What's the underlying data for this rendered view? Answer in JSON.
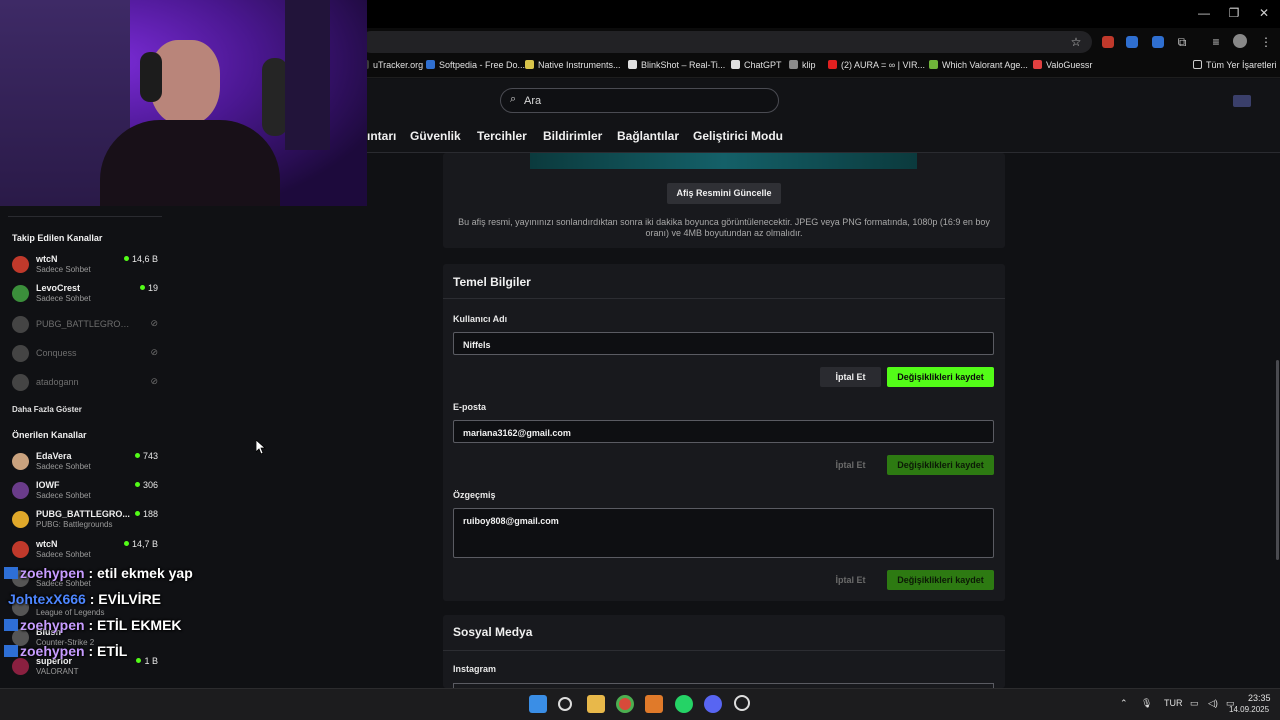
{
  "window": {
    "minimize": "—",
    "restore": "❐",
    "close": "✕"
  },
  "bookmarks": [
    {
      "label": "uTracker.org",
      "color": "#3a3a3a"
    },
    {
      "label": "Softpedia - Free Do...",
      "color": "#2f6fd0"
    },
    {
      "label": "Native Instruments...",
      "color": "#d8c44a"
    },
    {
      "label": "BlinkShot – Real-Ti...",
      "color": "#e0e0e0"
    },
    {
      "label": "ChatGPT",
      "color": "#e0e0e0"
    },
    {
      "label": "klip",
      "color": "#8a8a8a"
    },
    {
      "label": "(2) AURA = ∞ | VIR...",
      "color": "#e02020"
    },
    {
      "label": "Which Valorant Age...",
      "color": "#6fb43a"
    },
    {
      "label": "ValoGuessr",
      "color": "#e04040"
    }
  ],
  "bookmarks_other": "Tüm Yer İşaretleri",
  "search": {
    "placeholder": "Ara",
    "icon": "search-icon"
  },
  "tabs": [
    "ıntarı",
    "Güvenlik",
    "Tercihler",
    "Bildirimler",
    "Bağlantılar",
    "Geliştirici Modu"
  ],
  "banner": {
    "button": "Afiş Resmini Güncelle",
    "help": "Bu afiş resmi, yayınınızı sonlandırdıktan sonra iki dakika boyunca görüntülenecektir. JPEG veya PNG formatında, 1080p (16:9 en boy oranı) ve 4MB boyutundan az olmalıdır."
  },
  "basic_info": {
    "title": "Temel Bilgiler",
    "username_label": "Kullanıcı Adı",
    "username_value": "Niffels",
    "email_label": "E-posta",
    "email_value": "mariana3162@gmail.com",
    "bio_label": "Özgeçmiş",
    "bio_value": "ruiboy808@gmail.com",
    "cancel": "İptal Et",
    "save": "Değişiklikleri kaydet"
  },
  "social": {
    "title": "Sosyal Medya",
    "instagram_label": "Instagram"
  },
  "sidebar": {
    "followed_title": "Takip Edilen Kanallar",
    "followed": [
      {
        "name": "wtcN",
        "category": "Sadece Sohbet",
        "viewers": "14,6 B",
        "live": true,
        "color": "#c0392b"
      },
      {
        "name": "LevoCrest",
        "category": "Sadece Sohbet",
        "viewers": "19",
        "live": true,
        "color": "#3b8f3b"
      },
      {
        "name": "PUBG_BATTLEGROUN...",
        "category": "",
        "viewers": "⊘",
        "live": false,
        "color": "#444"
      },
      {
        "name": "Conquess",
        "category": "",
        "viewers": "⊘",
        "live": false,
        "color": "#444"
      },
      {
        "name": "atadogann",
        "category": "",
        "viewers": "⊘",
        "live": false,
        "color": "#444"
      }
    ],
    "show_more": "Daha Fazla Göster",
    "recommended_title": "Önerilen Kanallar",
    "recommended": [
      {
        "name": "EdaVera",
        "category": "Sadece Sohbet",
        "viewers": "743",
        "color": "#c9a27e"
      },
      {
        "name": "IOWF",
        "category": "Sadece Sohbet",
        "viewers": "306",
        "color": "#6a3c8a"
      },
      {
        "name": "PUBG_BATTLEGRO...",
        "category": "PUBG: Battlegrounds",
        "viewers": "188",
        "color": "#e0a82a"
      },
      {
        "name": "wtcN",
        "category": "Sadece Sohbet",
        "viewers": "14,7 B",
        "color": "#c0392b"
      },
      {
        "name": "",
        "category": "Sadece Sohbet",
        "viewers": "",
        "color": "#555"
      },
      {
        "name": "",
        "category": "League of Legends",
        "viewers": "",
        "color": "#555"
      },
      {
        "name": "Blush",
        "category": "Counter-Strike 2",
        "viewers": "",
        "color": "#555"
      },
      {
        "name": "superior",
        "category": "VALORANT",
        "viewers": "1 B",
        "color": "#8a2040"
      }
    ]
  },
  "chat": [
    {
      "user": "zoehypen",
      "text": " : etil ekmek yap",
      "badge": true,
      "blue": false
    },
    {
      "user": "JohtexX666",
      "text": " : EVİLVİRE",
      "badge": false,
      "blue": true
    },
    {
      "user": "zoehypen",
      "text": " : ETİL EKMEK",
      "badge": true,
      "blue": false
    },
    {
      "user": "zoehypen",
      "text": " : ETİL",
      "badge": true,
      "blue": false
    }
  ],
  "taskbar": {
    "lang": "TUR",
    "time": "23:35",
    "date": "14.09.2025"
  },
  "colors": {
    "save_active": "#53fc18",
    "save_disabled": "#2d7a12",
    "cancel_active": "#2a2b30"
  }
}
